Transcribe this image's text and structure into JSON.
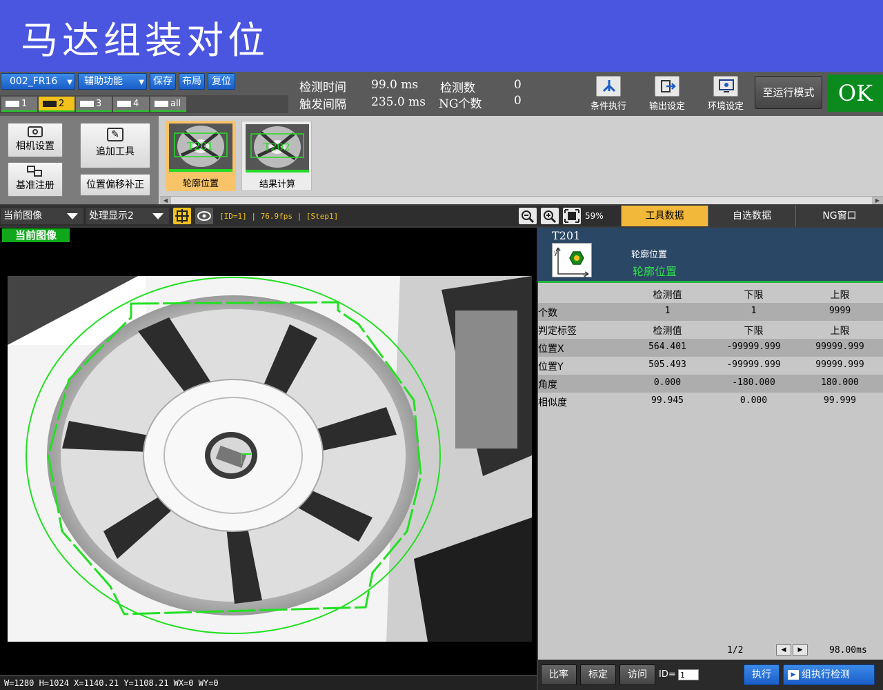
{
  "title": "马达组装对位",
  "toolbar": {
    "program": "002_FR16",
    "aux": "辅助功能",
    "save": "保存",
    "layout": "布局",
    "reset": "复位",
    "tabs": [
      "1",
      "2",
      "3",
      "4",
      "all"
    ],
    "detect_time_label": "检测时间",
    "detect_time_value": "99.0 ms",
    "trigger_interval_label": "触发间隔",
    "trigger_interval_value": "235.0 ms",
    "detect_count_label": "检测数",
    "detect_count_value": "0",
    "ng_count_label": "NG个数",
    "ng_count_value": "0",
    "cond_exec": "条件执行",
    "output_settings": "输出设定",
    "env_settings": "环境设定",
    "run_mode": "至运行模式",
    "result": "OK"
  },
  "tools": {
    "camera_settings": "相机设置",
    "ref_register": "基准注册",
    "add_tool": "追加工具",
    "pos_offset": "位置偏移补正",
    "items": [
      {
        "id": "T201",
        "label": "轮廓位置",
        "selected": true
      },
      {
        "id": "T202",
        "label": "结果计算",
        "selected": false
      }
    ]
  },
  "image_toolbar": {
    "image_select": "当前图像",
    "display_select": "处理显示2",
    "info": "[ID=1] | 76.9fps | [Step1]",
    "zoom": "59%"
  },
  "right_tabs": [
    "工具数据",
    "自选数据",
    "NG窗口"
  ],
  "image_view": {
    "label": "当前图像",
    "status": "W=1280  H=1024  X=1140.21  Y=1108.21 WX=0 WY=0"
  },
  "tool_detail": {
    "id": "T201",
    "type": "轮廓位置",
    "name": "轮廓位置",
    "headers": [
      "",
      "检测值",
      "下限",
      "上限"
    ],
    "rows": [
      [
        "个数",
        "1",
        "1",
        "9999"
      ],
      [
        "判定标签",
        "检测值",
        "下限",
        "上限"
      ],
      [
        "位置X",
        "564.401",
        "-99999.999",
        "99999.999"
      ],
      [
        "位置Y",
        "505.493",
        "-99999.999",
        "99999.999"
      ],
      [
        "角度",
        "0.000",
        "-180.000",
        "180.000"
      ],
      [
        "相似度",
        "99.945",
        "0.000",
        "99.999"
      ]
    ],
    "page": "1/2",
    "time": "98.00ms"
  },
  "bottom_bar": {
    "ratio": "比率",
    "calibrate": "标定",
    "access": "访问",
    "id_label": "ID=",
    "id_value": "1",
    "execute": "执行",
    "group_exec": "组执行检测"
  },
  "colors": {
    "title_bg": "#4a55e0",
    "accent": "#f2c21b",
    "ok": "#0b8a1e",
    "overlay": "#22e022"
  }
}
